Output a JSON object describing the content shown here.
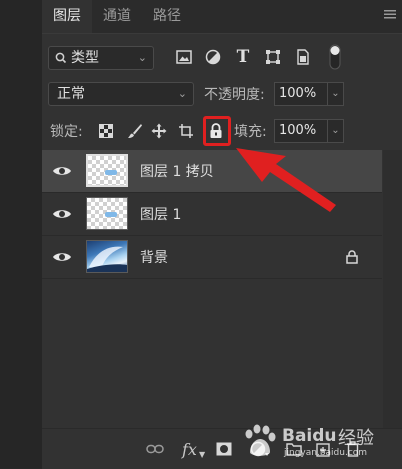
{
  "tabs": [
    {
      "label": "图层",
      "active": true
    },
    {
      "label": "通道",
      "active": false
    },
    {
      "label": "路径",
      "active": false
    }
  ],
  "filter": {
    "kind_label": "类型",
    "icons": [
      "image-filter-icon",
      "adjustment-filter-icon",
      "type-filter-icon",
      "shape-filter-icon",
      "smart-object-filter-icon",
      "filter-toggle-icon"
    ]
  },
  "blend": {
    "mode": "正常",
    "opacity_label": "不透明度:",
    "opacity_value": "100%"
  },
  "lock": {
    "label": "锁定:",
    "icons": [
      "lock-transparent-pixels-icon",
      "lock-image-pixels-icon",
      "lock-position-icon",
      "lock-artboard-icon",
      "lock-all-icon"
    ],
    "fill_label": "填充:",
    "fill_value": "100%"
  },
  "layers": [
    {
      "name": "图层 1 拷贝",
      "selected": true,
      "thumb": "transparent",
      "locked": false
    },
    {
      "name": "图层 1",
      "selected": false,
      "thumb": "transparent",
      "locked": false
    },
    {
      "name": "背景",
      "selected": false,
      "thumb": "image",
      "locked": true
    }
  ],
  "bottom_icons": [
    "link-layers-icon",
    "fx-icon",
    "mask-icon",
    "adjustment-layer-icon",
    "group-icon",
    "new-layer-icon",
    "delete-layer-icon"
  ],
  "bottom_fx_label": "fx",
  "colors": {
    "annotation": "#e02020",
    "panel_bg": "#323232",
    "selected_row": "#464646"
  },
  "watermark": {
    "brand": "Baidu",
    "text": "经验",
    "url": "jingyan.baidu.com"
  }
}
